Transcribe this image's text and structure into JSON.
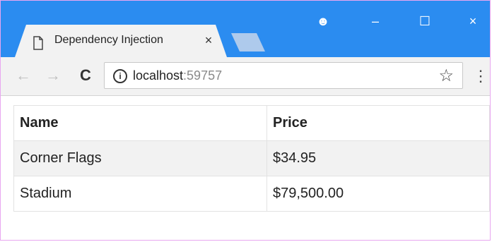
{
  "browser": {
    "tab_title": "Dependency Injection",
    "tab_close_glyph": "×",
    "window_controls": {
      "profile_glyph": "☻",
      "minimize_glyph": "–",
      "maximize_glyph": "☐",
      "close_glyph": "×"
    },
    "nav": {
      "back_glyph": "←",
      "forward_glyph": "→",
      "reload_glyph": "C"
    },
    "address": {
      "info_glyph": "i",
      "host": "localhost",
      "port": ":59757",
      "star_glyph": "☆",
      "menu_glyph": "⋮"
    },
    "colors": {
      "titlebar": "#2b8cf0",
      "tab": "#f2f2f2"
    }
  },
  "table": {
    "headers": [
      "Name",
      "Price"
    ],
    "rows": [
      [
        "Corner Flags",
        "$34.95"
      ],
      [
        "Stadium",
        "$79,500.00"
      ]
    ]
  }
}
